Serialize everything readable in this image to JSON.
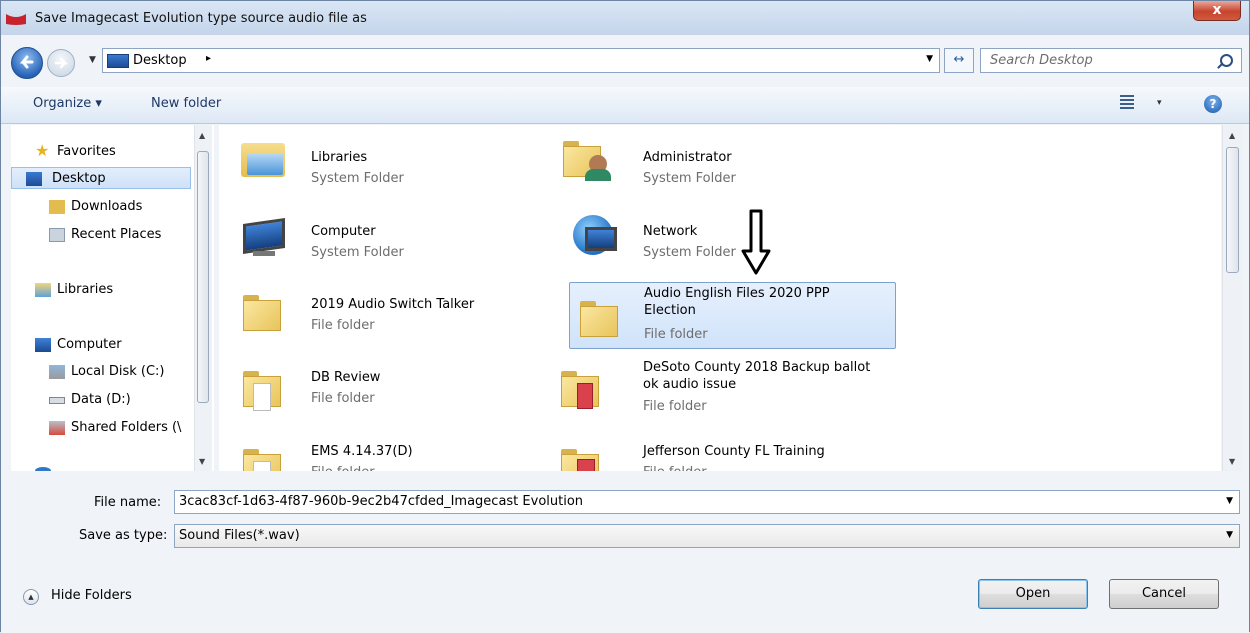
{
  "window": {
    "title": "Save Imagecast Evolution type source audio file as",
    "close_label": "x"
  },
  "address_bar": {
    "location": "Desktop",
    "chevron": "▸",
    "dropdown": "▼"
  },
  "search": {
    "placeholder": "Search Desktop"
  },
  "toolbar": {
    "organize_label": "Organize ▾",
    "new_folder_label": "New folder",
    "views_dropdown": "▾",
    "help_label": "?"
  },
  "sidebar": {
    "items": [
      {
        "label": "Favorites",
        "icon": "star-icon"
      },
      {
        "label": "Desktop",
        "icon": "desktop-icon",
        "selected": true
      },
      {
        "label": "Downloads",
        "icon": "downloads-icon"
      },
      {
        "label": "Recent Places",
        "icon": "recent-places-icon"
      },
      {
        "label": "Libraries",
        "icon": "libraries-icon"
      },
      {
        "label": "Computer",
        "icon": "computer-icon"
      },
      {
        "label": "Local Disk (C:)",
        "icon": "local-disk-icon"
      },
      {
        "label": "Data (D:)",
        "icon": "drive-icon"
      },
      {
        "label": "Shared Folders (\\",
        "icon": "shared-folder-icon"
      }
    ]
  },
  "files": [
    {
      "name": "Libraries",
      "type": "System Folder"
    },
    {
      "name": "Administrator",
      "type": "System Folder"
    },
    {
      "name": "Computer",
      "type": "System Folder"
    },
    {
      "name": "Network",
      "type": "System Folder"
    },
    {
      "name": "2019 Audio Switch Talker",
      "type": "File folder"
    },
    {
      "name": "Audio English Files 2020 PPP Election",
      "type": "File folder",
      "selected": true
    },
    {
      "name": "DB Review",
      "type": "File folder"
    },
    {
      "name": "DeSoto County 2018 Backup ballot ok audio issue",
      "type": "File folder"
    },
    {
      "name": "EMS 4.14.37(D)",
      "type": "File folder"
    },
    {
      "name": "Jefferson County FL Training",
      "type": "File folder"
    }
  ],
  "form": {
    "file_name_label": "File name:",
    "file_name_value": "3cac83cf-1d63-4f87-960b-9ec2b47cfded_Imagecast Evolution",
    "save_type_label": "Save as type:",
    "save_type_value": "Sound Files(*.wav)",
    "dropdown": "▼"
  },
  "footer": {
    "hide_folders_label": "Hide Folders",
    "open_label": "Open",
    "cancel_label": "Cancel"
  }
}
